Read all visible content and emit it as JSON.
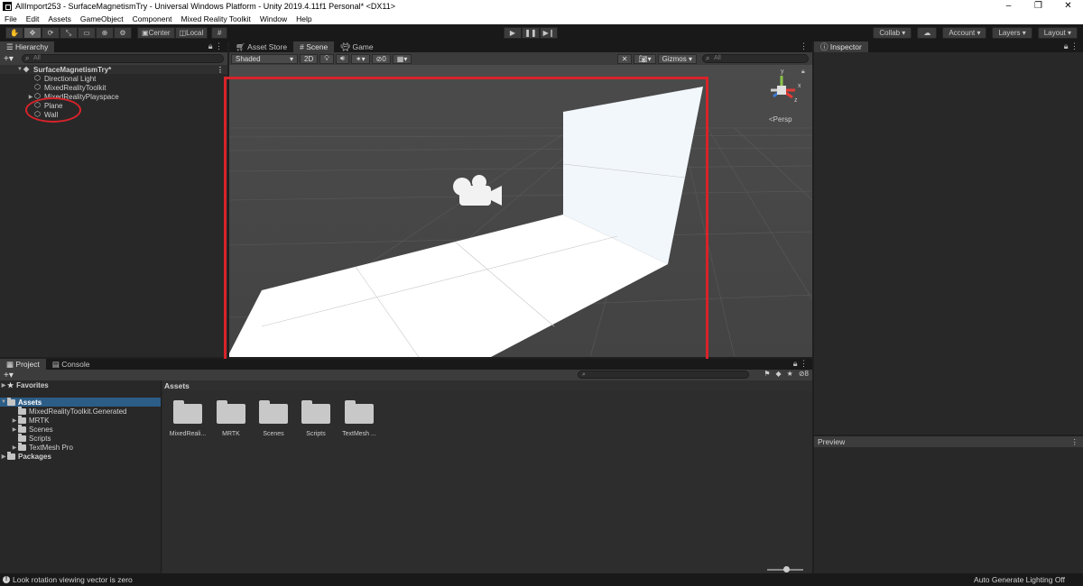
{
  "window": {
    "title": "AllImport253 - SurfaceMagnetismTry - Universal Windows Platform - Unity 2019.4.11f1 Personal* <DX11>",
    "buttons": [
      "–",
      "❐",
      "✕"
    ]
  },
  "menu": [
    "File",
    "Edit",
    "Assets",
    "GameObject",
    "Component",
    "Mixed Reality Toolkit",
    "Window",
    "Help"
  ],
  "toolbar": {
    "center_label": "Center",
    "local_label": "Local",
    "collab_label": "Collab ▾",
    "account_label": "Account ▾",
    "layers_label": "Layers ▾",
    "layout_label": "Layout ▾"
  },
  "hierarchy": {
    "tab": "Hierarchy",
    "search_placeholder": "All",
    "scene_name": "SurfaceMagnetismTry*",
    "items": [
      "Directional Light",
      "MixedRealityToolkit",
      "MixedRealityPlayspace",
      "Plane",
      "Wall"
    ]
  },
  "scene": {
    "tabs": [
      "Asset Store",
      "Scene",
      "Game"
    ],
    "shading": "Shaded",
    "mode_2d": "2D",
    "fx_count": "0",
    "gizmos": "Gizmos",
    "search_placeholder": "All",
    "persp_label": "<Persp",
    "gizmo_axes": [
      "y",
      "x",
      "z"
    ]
  },
  "inspector": {
    "tab": "Inspector"
  },
  "preview": {
    "label": "Preview"
  },
  "project": {
    "tabs": [
      "Project",
      "Console"
    ],
    "favorites": "Favorites",
    "assets_root": "Assets",
    "asset_children": [
      "MixedRealityToolkit.Generated",
      "MRTK",
      "Scenes",
      "Scripts",
      "TextMesh Pro"
    ],
    "packages": "Packages",
    "assets_header": "Assets",
    "hidden_count": "8",
    "tiles": [
      "MixedReali...",
      "MRTK",
      "Scenes",
      "Scripts",
      "TextMesh ..."
    ]
  },
  "status": {
    "message": "Look rotation viewing vector is zero",
    "right": "Auto Generate Lighting Off"
  }
}
